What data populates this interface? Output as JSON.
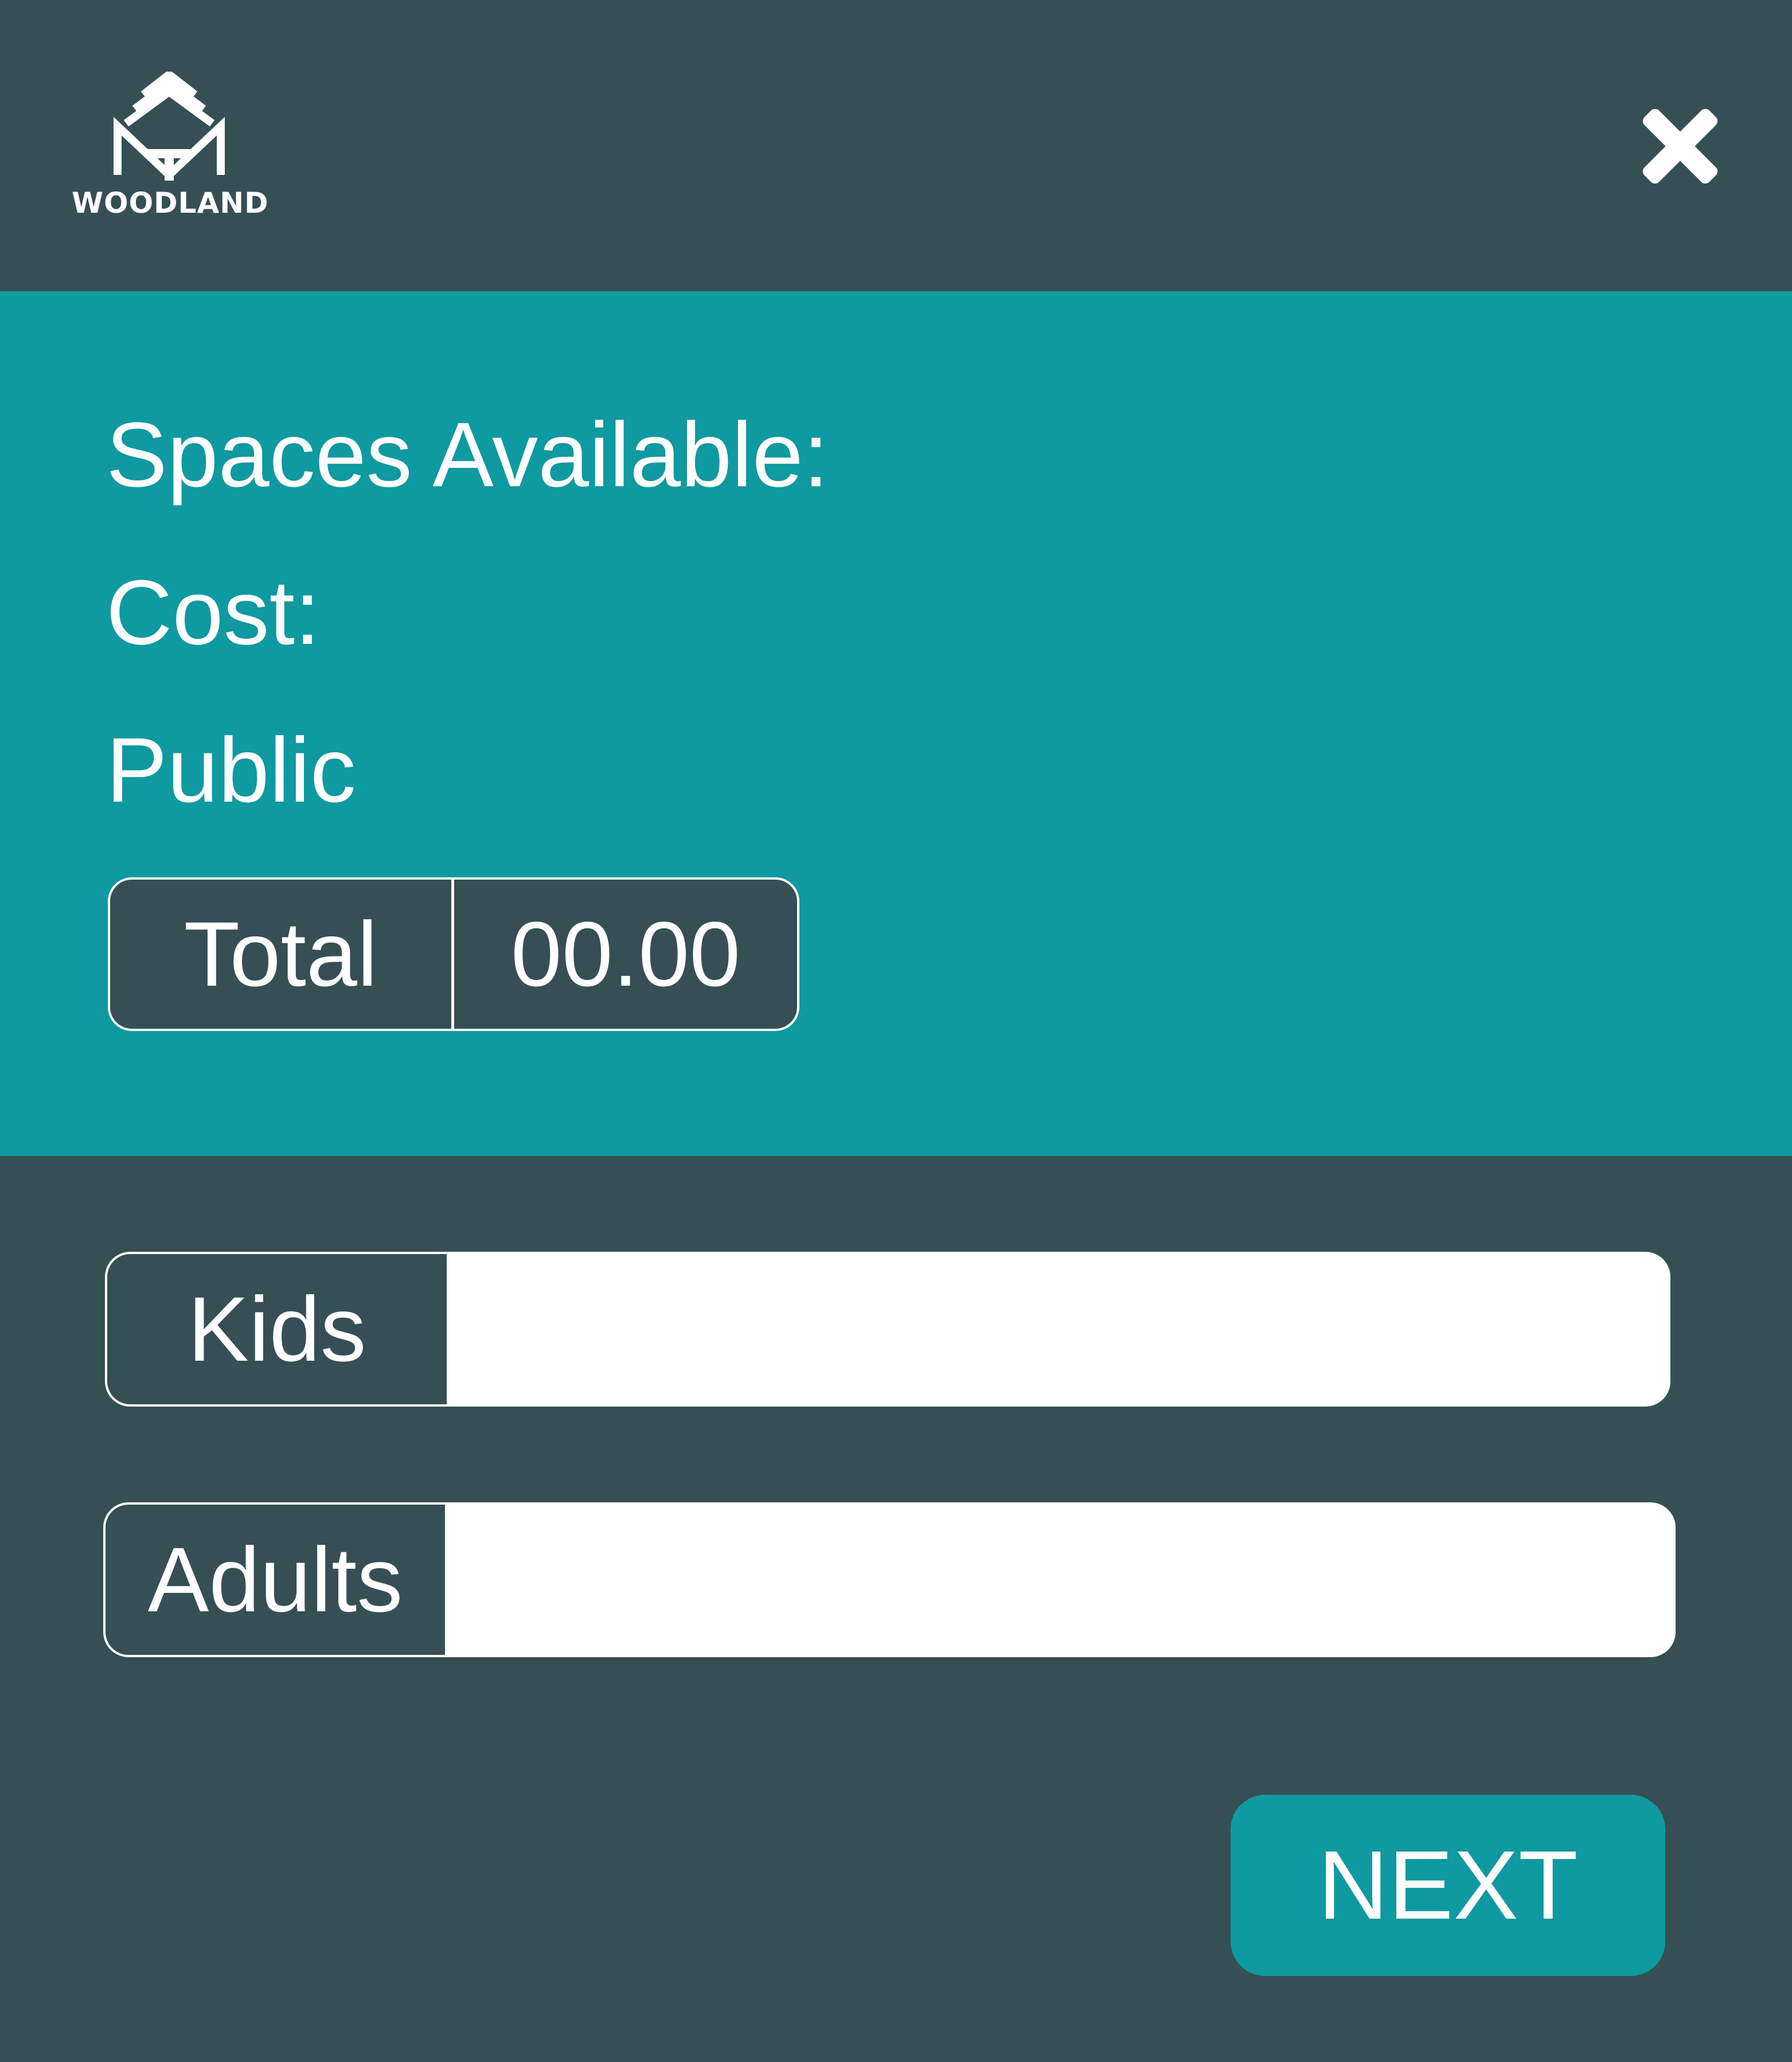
{
  "header": {
    "logo_text": "WOODLAND",
    "logo_icon": "woodland-tree-icon",
    "close_icon": "close-icon"
  },
  "info": {
    "spaces_label": "Spaces Available:",
    "cost_label": "Cost:",
    "access_label": "Public",
    "total_label": "Total",
    "total_value": "00.00"
  },
  "form": {
    "kids_label": "Kids",
    "kids_value": "",
    "adults_label": "Adults",
    "adults_value": ""
  },
  "actions": {
    "next_label": "NEXT"
  },
  "colors": {
    "dark": "#364f54",
    "teal": "#0f99a0",
    "white": "#ffffff"
  }
}
